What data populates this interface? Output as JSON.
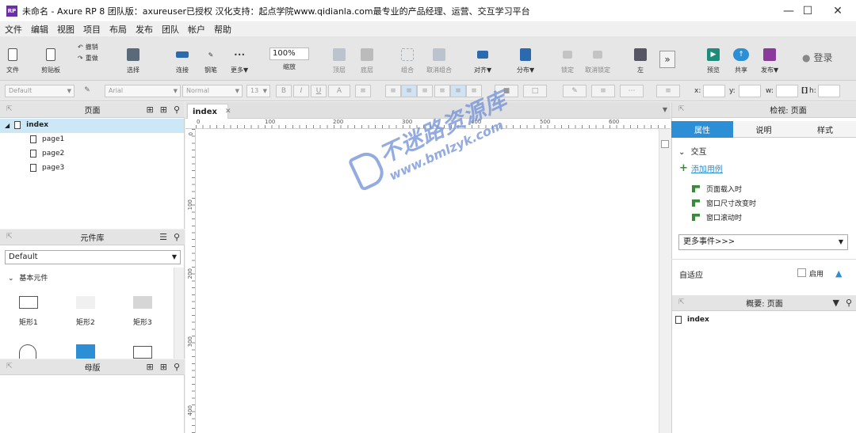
{
  "window": {
    "title": "未命名 - Axure RP 8 团队版：axureuser已授权 汉化支持：起点学院www.qidianla.com最专业的产品经理、运营、交互学习平台",
    "logo_text": "RP"
  },
  "menu": [
    "文件",
    "编辑",
    "视图",
    "项目",
    "布局",
    "发布",
    "团队",
    "帐户",
    "帮助"
  ],
  "toolbar": {
    "file": "文件",
    "clipboard": "剪贴板",
    "undo": "撤销",
    "redo": "重做",
    "select": "选择",
    "connect": "连接",
    "pen": "钢笔",
    "more": "更多▼",
    "zoom_value": "100%",
    "zoom": "缩放",
    "top": "顶层",
    "bottom": "底层",
    "group": "组合",
    "ungroup": "取消组合",
    "align": "对齐▼",
    "distribute": "分布▼",
    "lock": "锁定",
    "unlock": "取消锁定",
    "left": "左",
    "preview": "预览",
    "share": "共享",
    "publish": "发布▼",
    "login": "登录"
  },
  "formatbar": {
    "style": "Default",
    "font": "Arial",
    "weight": "Normal",
    "size": "13",
    "x": "x:",
    "y": "y:",
    "w": "w:",
    "h": "h:"
  },
  "pages_panel": {
    "title": "页面",
    "root": "index",
    "children": [
      "page1",
      "page2",
      "page3"
    ]
  },
  "widgets_panel": {
    "title": "元件库",
    "library": "Default",
    "section": "基本元件",
    "items": [
      "矩形1",
      "矩形2",
      "矩形3"
    ]
  },
  "masters_panel": {
    "title": "母版"
  },
  "canvas": {
    "tab": "index",
    "h_ticks": [
      "0",
      "100",
      "200",
      "300",
      "400",
      "500",
      "600"
    ],
    "v_ticks": [
      "0",
      "100",
      "200",
      "300",
      "400"
    ]
  },
  "inspector": {
    "title": "检视: 页面",
    "tabs": [
      "属性",
      "说明",
      "样式"
    ],
    "section": "交互",
    "add_case": "添加用例",
    "events": [
      "页面载入时",
      "窗口尺寸改变时",
      "窗口滚动时"
    ],
    "more_events": "更多事件>>>",
    "adaptive": "自适应",
    "enable": "启用"
  },
  "outline": {
    "title": "概要: 页面",
    "root": "index"
  },
  "watermark": {
    "main": "不迷路资源库",
    "url": "www.bmlzyk.com"
  },
  "colors": {
    "accent": "#2c8fd6",
    "selected": "#cce8f6",
    "green": "#3a8a3a"
  }
}
